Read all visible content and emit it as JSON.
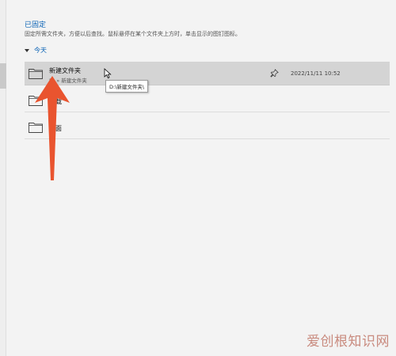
{
  "pinned": {
    "title": "已固定",
    "description": "固定所需文件夹，方便以后查找。鼠标悬停在某个文件夹上方时，单击显示的图钉图标。"
  },
  "group": {
    "label": "今天"
  },
  "rows": [
    {
      "name": "新建文件夹",
      "path": "D: » 新建文件夹",
      "date": "2022/11/11 10:52",
      "pin_icon": "pin-icon"
    },
    {
      "name": "下载"
    },
    {
      "name": "桌面"
    }
  ],
  "tooltip": {
    "text": "D:\\新建文件夹\\"
  },
  "icons": {
    "folder": "folder-icon",
    "cursor": "mouse-cursor-icon",
    "annotation": "red-arrow-annotation"
  },
  "colors": {
    "accent": "#0b63b6",
    "selected_row": "#d4d4d4",
    "annotation_arrow": "#e9542f"
  },
  "watermark": {
    "text": "爱创根知识网"
  }
}
